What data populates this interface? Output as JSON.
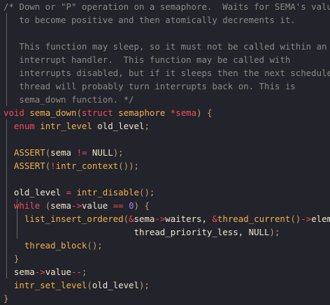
{
  "theme": {
    "background": "#22232b",
    "plain": "#f3e6c9",
    "comment": "#8d8a84",
    "keyword": "#f14e5b",
    "type": "#f0b24f",
    "function": "#f0b24f",
    "operator": "#f14e5b",
    "number": "#a67dff",
    "punct": "#c49e67",
    "guide": "#6a665f"
  },
  "code": {
    "lines": [
      {
        "tokens": [
          {
            "t": "/* Down or \"P\" operation on a semaphore.  Waits for SEMA's value",
            "k": "comment"
          }
        ]
      },
      {
        "tokens": [
          {
            "t": "   to become positive and then atomically decrements it.",
            "k": "comment"
          }
        ]
      },
      {
        "tokens": []
      },
      {
        "tokens": [
          {
            "t": "   This function may sleep, so it must not be called within an",
            "k": "comment"
          }
        ]
      },
      {
        "tokens": [
          {
            "t": "   interrupt handler.  This function may be called with",
            "k": "comment"
          }
        ]
      },
      {
        "tokens": [
          {
            "t": "   interrupts disabled, but if it sleeps then the next scheduled",
            "k": "comment"
          }
        ]
      },
      {
        "tokens": [
          {
            "t": "   thread will probably turn interrupts back on. This is",
            "k": "comment"
          }
        ]
      },
      {
        "tokens": [
          {
            "t": "   sema_down function. */",
            "k": "comment"
          }
        ]
      },
      {
        "tokens": [
          {
            "t": "void",
            "k": "keyword"
          },
          {
            "t": " ",
            "k": "plain"
          },
          {
            "t": "sema_down",
            "k": "function"
          },
          {
            "t": "(",
            "k": "punct"
          },
          {
            "t": "struct",
            "k": "keyword"
          },
          {
            "t": " ",
            "k": "plain"
          },
          {
            "t": "semaphore",
            "k": "type"
          },
          {
            "t": " ",
            "k": "plain"
          },
          {
            "t": "*",
            "k": "operator"
          },
          {
            "t": "sema",
            "k": "keyword"
          },
          {
            "t": ") {",
            "k": "punct"
          }
        ]
      },
      {
        "tokens": [
          {
            "t": "  ",
            "k": "plain"
          },
          {
            "t": "enum",
            "k": "keyword"
          },
          {
            "t": " ",
            "k": "plain"
          },
          {
            "t": "intr_level",
            "k": "type"
          },
          {
            "t": " old_level",
            "k": "plain"
          },
          {
            "t": ";",
            "k": "punct"
          }
        ]
      },
      {
        "tokens": []
      },
      {
        "tokens": [
          {
            "t": "  ",
            "k": "plain"
          },
          {
            "t": "ASSERT",
            "k": "macro"
          },
          {
            "t": "(",
            "k": "punct"
          },
          {
            "t": "sema",
            "k": "plain"
          },
          {
            "t": " ",
            "k": "plain"
          },
          {
            "t": "!=",
            "k": "operator"
          },
          {
            "t": " ",
            "k": "plain"
          },
          {
            "t": "NULL",
            "k": "plain"
          },
          {
            "t": ");",
            "k": "punct"
          }
        ]
      },
      {
        "tokens": [
          {
            "t": "  ",
            "k": "plain"
          },
          {
            "t": "ASSERT",
            "k": "macro"
          },
          {
            "t": "(",
            "k": "punct"
          },
          {
            "t": "!",
            "k": "operator"
          },
          {
            "t": "intr_context",
            "k": "function"
          },
          {
            "t": "());",
            "k": "punct"
          }
        ]
      },
      {
        "tokens": []
      },
      {
        "tokens": [
          {
            "t": "  old_level ",
            "k": "plain"
          },
          {
            "t": "=",
            "k": "operator"
          },
          {
            "t": " ",
            "k": "plain"
          },
          {
            "t": "intr_disable",
            "k": "function"
          },
          {
            "t": "();",
            "k": "punct"
          }
        ]
      },
      {
        "tokens": [
          {
            "t": "  ",
            "k": "plain"
          },
          {
            "t": "while",
            "k": "keyword"
          },
          {
            "t": " (",
            "k": "punct"
          },
          {
            "t": "sema",
            "k": "plain"
          },
          {
            "t": "->",
            "k": "operator"
          },
          {
            "t": "value ",
            "k": "plain"
          },
          {
            "t": "==",
            "k": "operator"
          },
          {
            "t": " ",
            "k": "plain"
          },
          {
            "t": "0",
            "k": "number"
          },
          {
            "t": ") {",
            "k": "punct"
          }
        ]
      },
      {
        "tokens": [
          {
            "t": "    ",
            "k": "plain"
          },
          {
            "t": "list_insert_ordered",
            "k": "function"
          },
          {
            "t": "(",
            "k": "punct"
          },
          {
            "t": "&",
            "k": "operator"
          },
          {
            "t": "sema",
            "k": "plain"
          },
          {
            "t": "->",
            "k": "operator"
          },
          {
            "t": "waiters, ",
            "k": "plain"
          },
          {
            "t": "&",
            "k": "operator"
          },
          {
            "t": "thread_current",
            "k": "function"
          },
          {
            "t": "()",
            "k": "punct"
          },
          {
            "t": "->",
            "k": "operator"
          },
          {
            "t": "elem,",
            "k": "plain"
          }
        ]
      },
      {
        "tokens": [
          {
            "t": "                         thread_priority_less, ",
            "k": "plain"
          },
          {
            "t": "NULL",
            "k": "plain"
          },
          {
            "t": ");",
            "k": "punct"
          }
        ]
      },
      {
        "tokens": [
          {
            "t": "    ",
            "k": "plain"
          },
          {
            "t": "thread_block",
            "k": "function"
          },
          {
            "t": "();",
            "k": "punct"
          }
        ]
      },
      {
        "tokens": [
          {
            "t": "  }",
            "k": "punct"
          }
        ]
      },
      {
        "tokens": [
          {
            "t": "  ",
            "k": "plain"
          },
          {
            "t": "sema",
            "k": "plain"
          },
          {
            "t": "->",
            "k": "operator"
          },
          {
            "t": "value",
            "k": "plain"
          },
          {
            "t": "--",
            "k": "operator"
          },
          {
            "t": ";",
            "k": "punct"
          }
        ]
      },
      {
        "tokens": [
          {
            "t": "  ",
            "k": "plain"
          },
          {
            "t": "intr_set_level",
            "k": "function"
          },
          {
            "t": "(",
            "k": "punct"
          },
          {
            "t": "old_level",
            "k": "plain"
          },
          {
            "t": ");",
            "k": "punct"
          }
        ]
      },
      {
        "tokens": [
          {
            "t": "}",
            "k": "punct"
          }
        ]
      }
    ]
  }
}
